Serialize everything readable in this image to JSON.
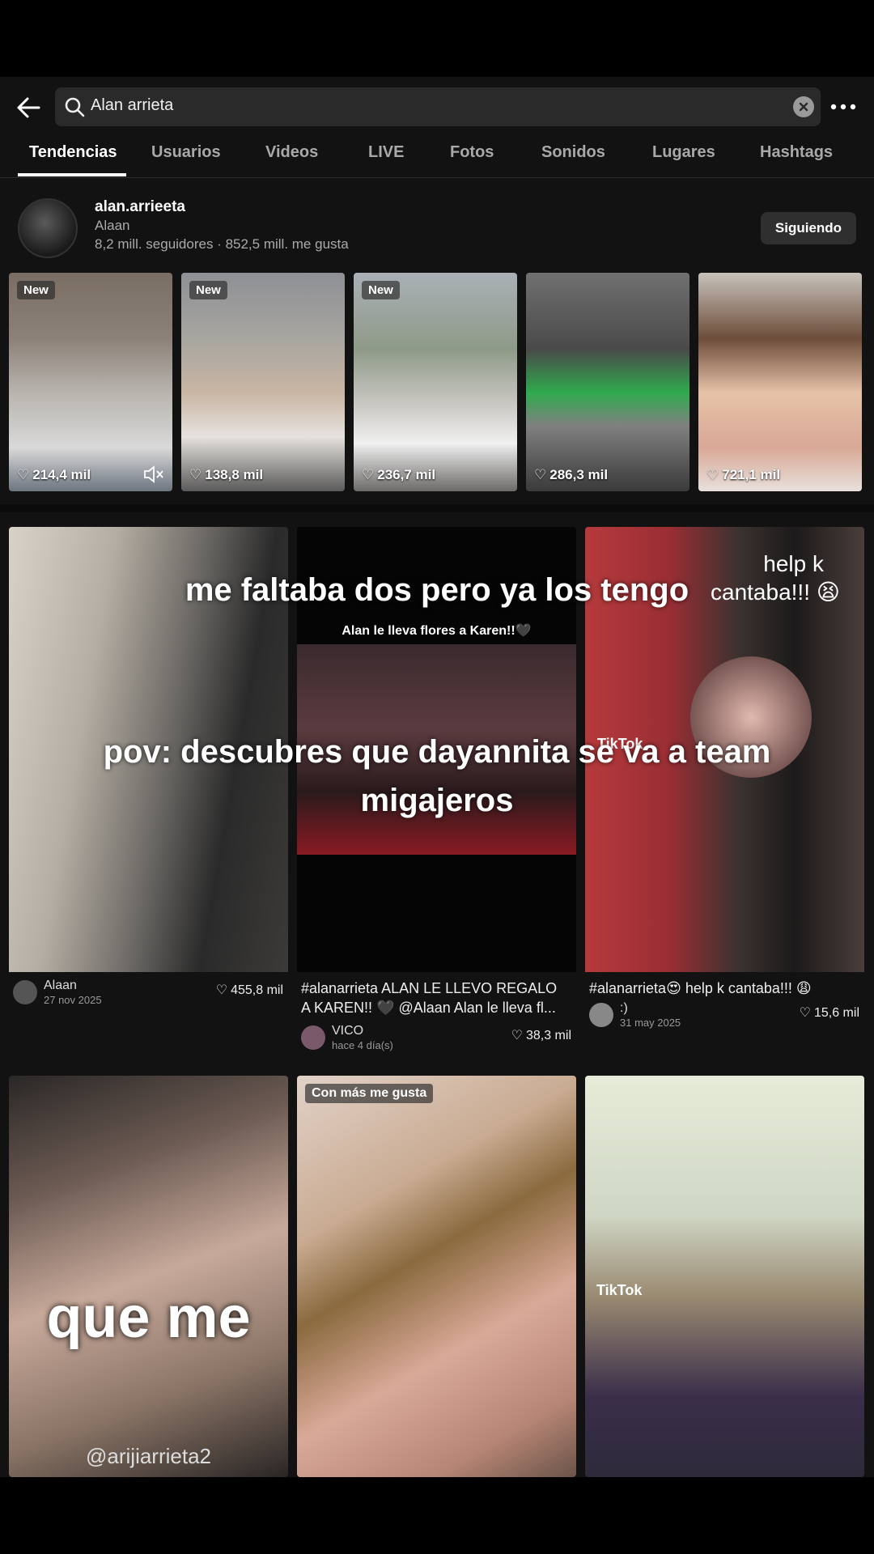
{
  "search": {
    "query": "Alan arrieta"
  },
  "tabs": [
    "Tendencias",
    "Usuarios",
    "Videos",
    "LIVE",
    "Fotos",
    "Sonidos",
    "Lugares",
    "Hashtags"
  ],
  "active_tab": "Tendencias",
  "profile": {
    "handle": "alan.arrieeta",
    "name": "Alaan",
    "stats": "8,2 mill. seguidores · 852,5 mill. me gusta",
    "follow_label": "Siguiendo"
  },
  "stories": [
    {
      "badge": "New",
      "likes": "214,4 mil",
      "muted": true
    },
    {
      "badge": "New",
      "likes": "138,8 mil"
    },
    {
      "badge": "New",
      "likes": "236,7 mil"
    },
    {
      "badge": "",
      "likes": "286,3 mil"
    },
    {
      "badge": "",
      "likes": "721,1 mil"
    }
  ],
  "overlays": {
    "top": "me faltaba dos pero ya los tengo",
    "pov_line1": "pov: descubres que dayannita se va a team",
    "pov_line2": "migajeros",
    "flowers": "Alan le lleva flores a Karen!!🖤",
    "help_line1": "help k",
    "help_line2": "cantaba!!! 😫",
    "tiktok_wm": "TikTok",
    "queme": "que me",
    "queme_handle": "@arijiarrieta2",
    "top_badge": "Con más me gusta"
  },
  "videos": [
    {
      "caption": "",
      "author": "Alaan",
      "date": "27 nov 2025",
      "likes": "455,8 mil"
    },
    {
      "caption_line1": "#alanarrieta ALAN LE LLEVO REGALO",
      "caption_line2": "A KAREN!! 🖤 @Alaan Alan le lleva fl...",
      "author": "VICO",
      "date": "hace 4 día(s)",
      "likes": "38,3 mil"
    },
    {
      "caption_line1": "#alanarrieta😍 help k cantaba!!! 😩",
      "author": ":)",
      "date": "31 may 2025",
      "likes": "15,6 mil"
    }
  ]
}
